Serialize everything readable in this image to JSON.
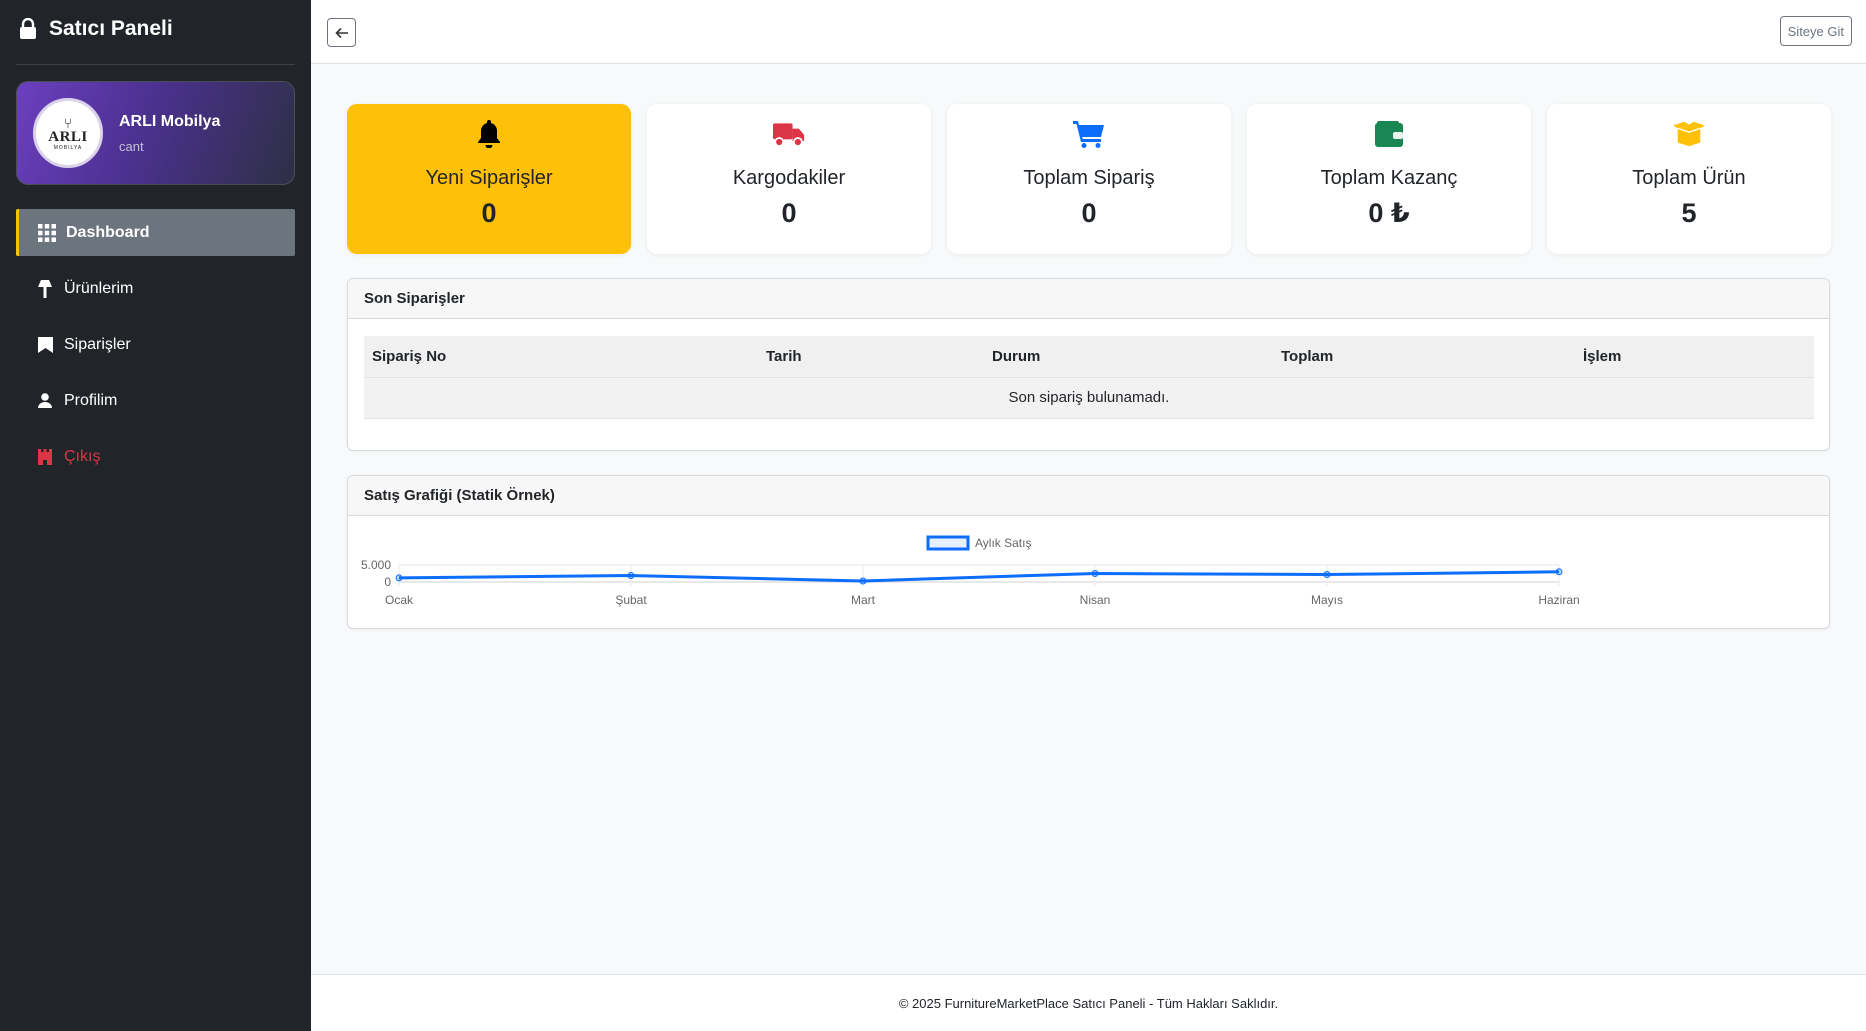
{
  "sidebar": {
    "brand": "Satıcı Paneli",
    "profile": {
      "name": "ARLI Mobilya",
      "sub": "cant",
      "logo_word": "ARLI",
      "logo_sub": "MOBILYA"
    },
    "items": [
      {
        "label": "Dashboard",
        "icon": "grid-icon"
      },
      {
        "label": "Ürünlerim",
        "icon": "lamp-icon"
      },
      {
        "label": "Siparişler",
        "icon": "shop-icon"
      },
      {
        "label": "Profilim",
        "icon": "person-icon"
      }
    ],
    "logout": "Çıkış"
  },
  "topbar": {
    "site_button": "Siteye Git"
  },
  "stats": [
    {
      "title": "Yeni Siparişler",
      "value": "0",
      "icon": "bell-icon",
      "color": "#000000"
    },
    {
      "title": "Kargodakiler",
      "value": "0",
      "icon": "truck-icon",
      "color": "#dc3545"
    },
    {
      "title": "Toplam Sipariş",
      "value": "0",
      "icon": "cart-icon",
      "color": "#0d6efd"
    },
    {
      "title": "Toplam Kazanç",
      "value": "0 ₺",
      "icon": "wallet-icon",
      "color": "#198754"
    },
    {
      "title": "Toplam Ürün",
      "value": "5",
      "icon": "box-icon",
      "color": "#ffc107"
    }
  ],
  "orders": {
    "title": "Son Siparişler",
    "columns": [
      "Sipariş No",
      "Tarih",
      "Durum",
      "Toplam",
      "İşlem"
    ],
    "empty": "Son sipariş bulunamadı."
  },
  "chart": {
    "title": "Satış Grafiği (Statik Örnek)"
  },
  "chart_data": {
    "type": "line",
    "x": [
      "Ocak",
      "Şubat",
      "Mart",
      "Nisan",
      "Mayıs",
      "Haziran"
    ],
    "series": [
      {
        "name": "Aylık Satış",
        "values": [
          1200,
          1900,
          300,
          2500,
          2200,
          3000
        ],
        "color": "#0d6efd"
      }
    ],
    "ylim": [
      0,
      5000
    ],
    "yticks": [
      "5.000",
      "0"
    ],
    "legend": "top"
  },
  "footer": "© 2025 FurnitureMarketPlace Satıcı Paneli - Tüm Hakları Saklıdır."
}
